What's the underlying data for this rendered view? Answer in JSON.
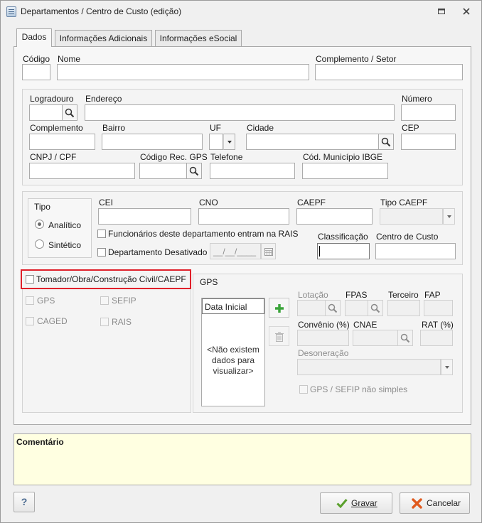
{
  "window": {
    "title": "Departamentos / Centro de Custo (edição)"
  },
  "tabs": [
    {
      "label": "Dados",
      "active": true
    },
    {
      "label": "Informações Adicionais",
      "active": false
    },
    {
      "label": "Informações eSocial",
      "active": false
    }
  ],
  "header_fields": {
    "codigo_label": "Código",
    "nome_label": "Nome",
    "complemento_setor_label": "Complemento / Setor"
  },
  "address": {
    "logradouro_label": "Logradouro",
    "endereco_label": "Endereço",
    "numero_label": "Número",
    "complemento_label": "Complemento",
    "bairro_label": "Bairro",
    "uf_label": "UF",
    "cidade_label": "Cidade",
    "cep_label": "CEP",
    "cnpj_label": "CNPJ / CPF",
    "cod_rec_gps_label": "Código Rec. GPS",
    "telefone_label": "Telefone",
    "cod_municipio_label": "Cód. Município IBGE"
  },
  "tipo": {
    "legend": "Tipo",
    "analitico": "Analítico",
    "sintetico": "Sintético",
    "selected": "Analítico"
  },
  "registros": {
    "cei_label": "CEI",
    "cno_label": "CNO",
    "caepf_label": "CAEPF",
    "tipo_caepf_label": "Tipo CAEPF",
    "rais_check": "Funcionários deste departamento entram na RAIS",
    "desativado_check": "Departamento Desativado",
    "date_placeholder": "__/__/____",
    "classificacao_label": "Classificação",
    "centro_custo_label": "Centro de Custo"
  },
  "tomador": {
    "label": "Tomador/Obra/Construção Civil/CAEPF",
    "gps": "GPS",
    "sefip": "SEFIP",
    "caged": "CAGED",
    "rais": "RAIS"
  },
  "gps_section": {
    "legend": "GPS",
    "grid_header": "Data Inicial",
    "empty_text": "<Não existem dados para visualizar>",
    "lotacao_label": "Lotação",
    "fpas_label": "FPAS",
    "terceiro_label": "Terceiro",
    "fap_label": "FAP",
    "convenio_label": "Convênio (%)",
    "cnae_label": "CNAE",
    "rat_label": "RAT (%)",
    "desoneracao_label": "Desoneração",
    "nao_simples": "GPS / SEFIP não simples"
  },
  "comentario": {
    "label": "Comentário"
  },
  "footer": {
    "help": "?",
    "gravar": "Gravar",
    "cancelar": "Cancelar"
  },
  "colors": {
    "highlight_border": "#e0202a",
    "comment_bg": "#ffffe1"
  }
}
